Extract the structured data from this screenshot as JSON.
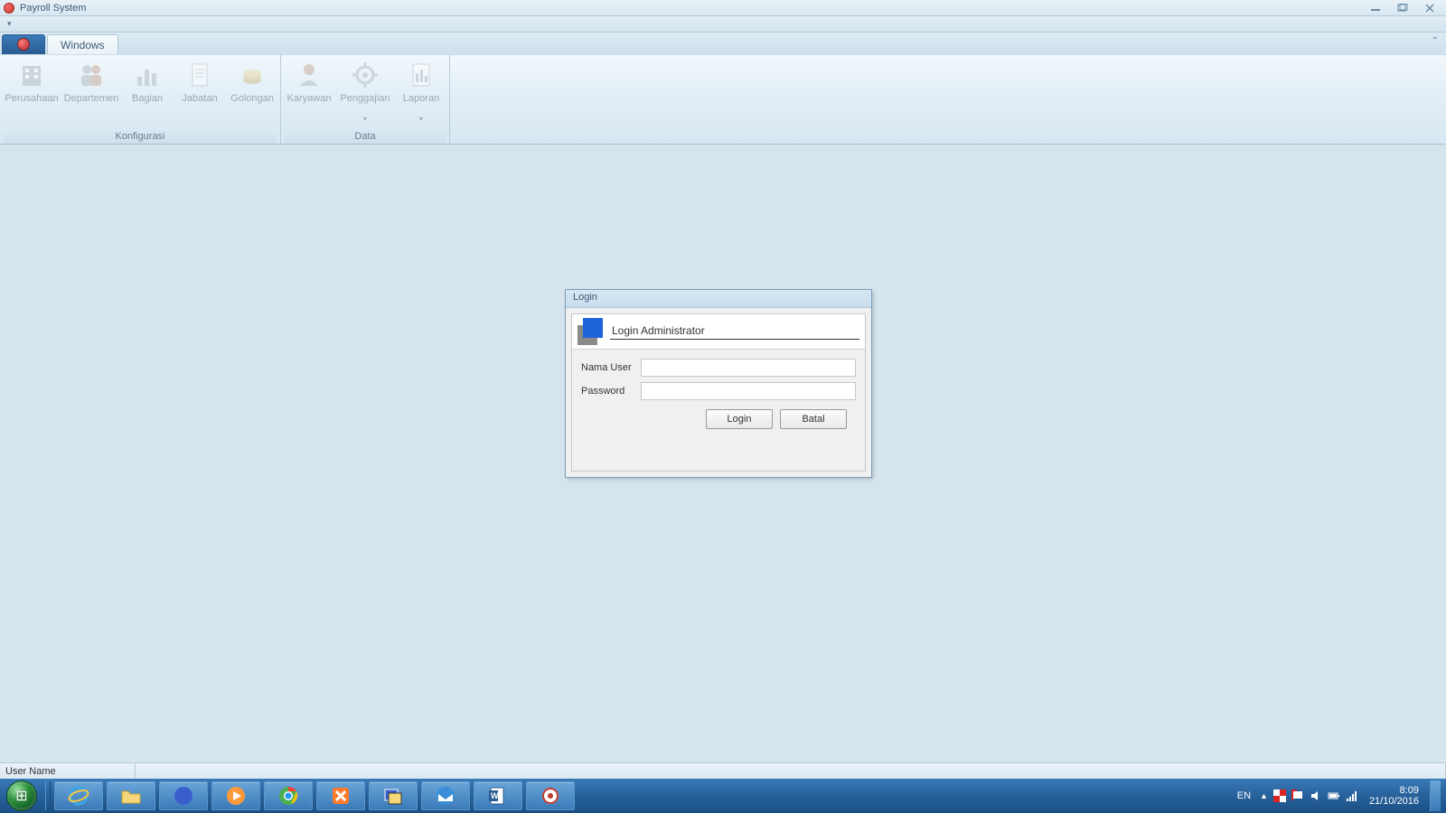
{
  "window": {
    "title": "Payroll System"
  },
  "ribbon": {
    "tabs": [
      {
        "label": "Windows"
      }
    ],
    "groups": [
      {
        "label": "Konfigurasi",
        "items": [
          {
            "label": "Perusahaan",
            "icon": "building-icon"
          },
          {
            "label": "Departemen",
            "icon": "people-icon"
          },
          {
            "label": "Bagian",
            "icon": "chart-icon"
          },
          {
            "label": "Jabatan",
            "icon": "document-icon"
          },
          {
            "label": "Golongan",
            "icon": "coins-icon"
          }
        ]
      },
      {
        "label": "Data",
        "items": [
          {
            "label": "Karyawan",
            "icon": "person-icon"
          },
          {
            "label": "Penggajian",
            "icon": "gear-icon",
            "dropdown": true
          },
          {
            "label": "Laporan",
            "icon": "report-icon",
            "dropdown": true
          }
        ]
      }
    ]
  },
  "login_dialog": {
    "title": "Login",
    "header": "Login Administrator",
    "username_label": "Nama User",
    "username_value": "",
    "password_label": "Password",
    "password_value": "",
    "login_btn": "Login",
    "cancel_btn": "Batal"
  },
  "statusbar": {
    "username_label": "User Name"
  },
  "taskbar": {
    "items": [
      {
        "name": "ie-icon"
      },
      {
        "name": "explorer-icon"
      },
      {
        "name": "firefox-icon"
      },
      {
        "name": "media-icon"
      },
      {
        "name": "chrome-icon"
      },
      {
        "name": "xampp-icon"
      },
      {
        "name": "putty-icon"
      },
      {
        "name": "thunderbird-icon"
      },
      {
        "name": "word-icon"
      },
      {
        "name": "app-icon"
      }
    ],
    "lang": "EN",
    "time": "8:09",
    "date": "21/10/2016"
  }
}
